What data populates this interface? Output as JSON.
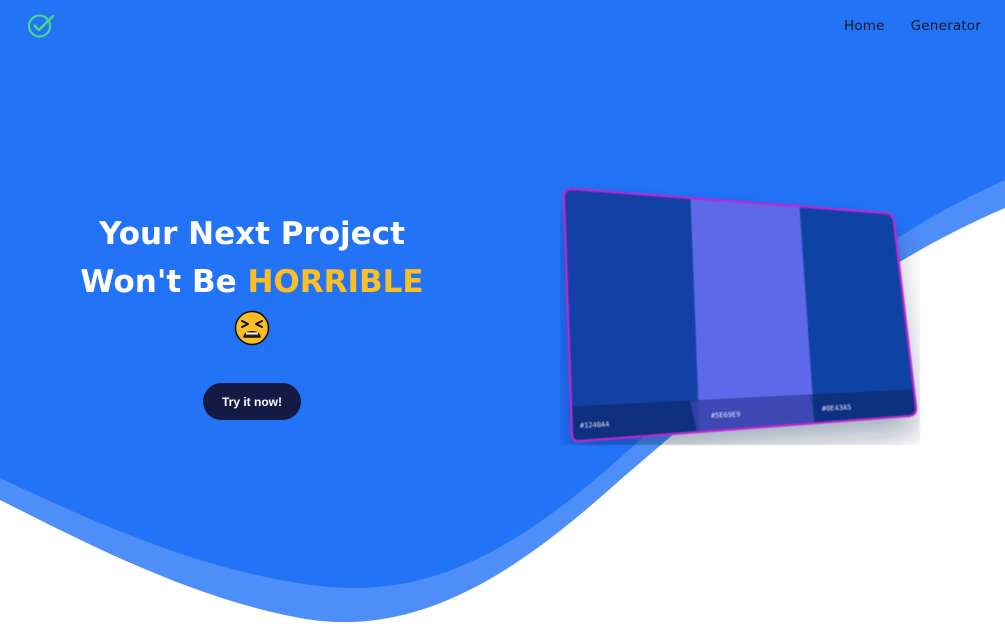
{
  "nav": {
    "logo_icon": "check-circle-icon",
    "links": [
      {
        "label": "Home"
      },
      {
        "label": "Generator"
      }
    ]
  },
  "hero": {
    "title_line1": "Your Next Project",
    "title_line2_prefix": "Won't Be ",
    "title_accent": "HORRIBLE",
    "emoji_icon": "tired-face-emoji-icon",
    "cta_label": "Try it now!"
  },
  "palette": {
    "swatches": [
      {
        "hex": "#1240A4",
        "label": "#1240A4"
      },
      {
        "hex": "#5E69E9",
        "label": "#5E69E9"
      },
      {
        "hex": "#0E43A5",
        "label": "#0E43A5"
      }
    ]
  },
  "colors": {
    "hero_blue": "#2373f7",
    "wave_light_blue": "#4d8ef8",
    "accent_yellow": "#fbbf24",
    "cta_navy": "#141a44",
    "logo_green": "#4ade80",
    "palette_border": "#c026d3"
  }
}
